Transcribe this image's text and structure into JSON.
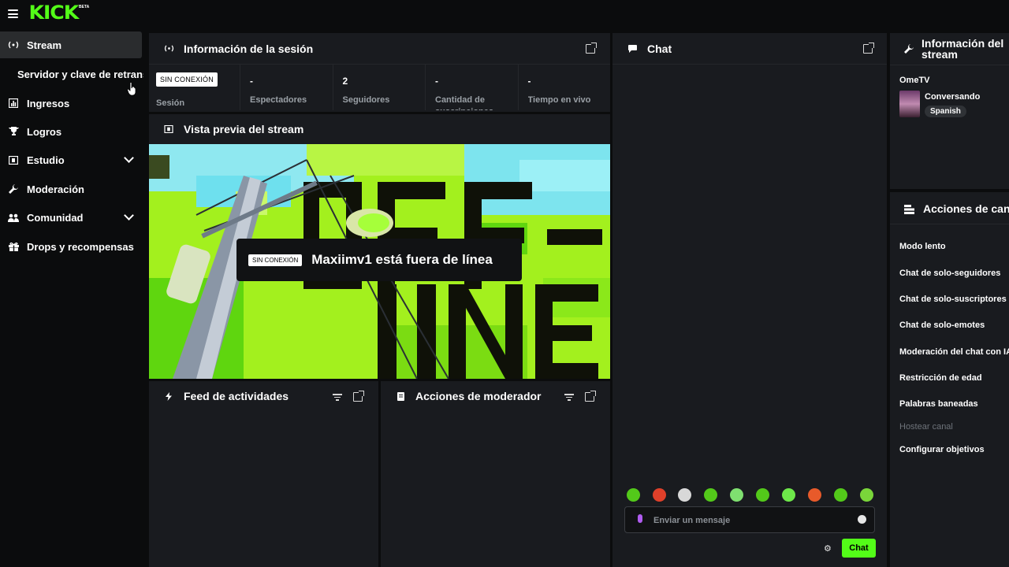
{
  "brand": {
    "logo": "KICK",
    "beta": "BETA",
    "accent": "#53fc18"
  },
  "sidebar": {
    "items": [
      {
        "label": "Stream",
        "icon": "broadcast-icon"
      },
      {
        "label": "Servidor y clave de retransmisión"
      },
      {
        "label": "Ingresos",
        "icon": "chart-icon"
      },
      {
        "label": "Logros",
        "icon": "trophy-icon"
      },
      {
        "label": "Estudio",
        "icon": "film-icon"
      },
      {
        "label": "Moderación",
        "icon": "wrench-icon"
      },
      {
        "label": "Comunidad",
        "icon": "users-icon"
      },
      {
        "label": "Drops y recompensas",
        "icon": "gift-icon"
      }
    ]
  },
  "session": {
    "title": "Información de la sesión",
    "offline_badge": "SIN CONEXIÓN",
    "session_label": "Sesión",
    "stats": [
      {
        "value": "-",
        "label": "Espectadores"
      },
      {
        "value": "2",
        "label": "Seguidores"
      },
      {
        "value": "-",
        "label": "Cantidad de suscripciones"
      },
      {
        "value": "-",
        "label": "Tiempo en vivo"
      }
    ]
  },
  "preview": {
    "title": "Vista previa del stream",
    "offline_badge": "SIN CONEXIÓN",
    "offline_text": "Maxiimv1 está fuera de línea",
    "art_text_top": "OFF-",
    "art_text_bottom": "LINE"
  },
  "activity": {
    "title": "Feed de actividades"
  },
  "moderator": {
    "title": "Acciones de moderador"
  },
  "chat": {
    "title": "Chat",
    "placeholder": "Enviar un mensaje",
    "send_label": "Chat"
  },
  "stream_info": {
    "title_line1": "Información del",
    "title_line2": "stream",
    "category": "OmeTV",
    "tag": "Conversando",
    "language": "Spanish"
  },
  "channel_actions": {
    "title": "Acciones de canal",
    "items": [
      {
        "label": "Modo lento"
      },
      {
        "label": "Chat de solo-seguidores"
      },
      {
        "label": "Chat de solo-suscriptores"
      },
      {
        "label": "Chat de solo-emotes"
      },
      {
        "label": "Moderación del chat con IA"
      },
      {
        "label": "Restricción de edad"
      },
      {
        "label": "Palabras baneadas"
      },
      {
        "label": "Hostear canal",
        "disabled": true
      },
      {
        "label": "Configurar objetivos"
      }
    ]
  }
}
